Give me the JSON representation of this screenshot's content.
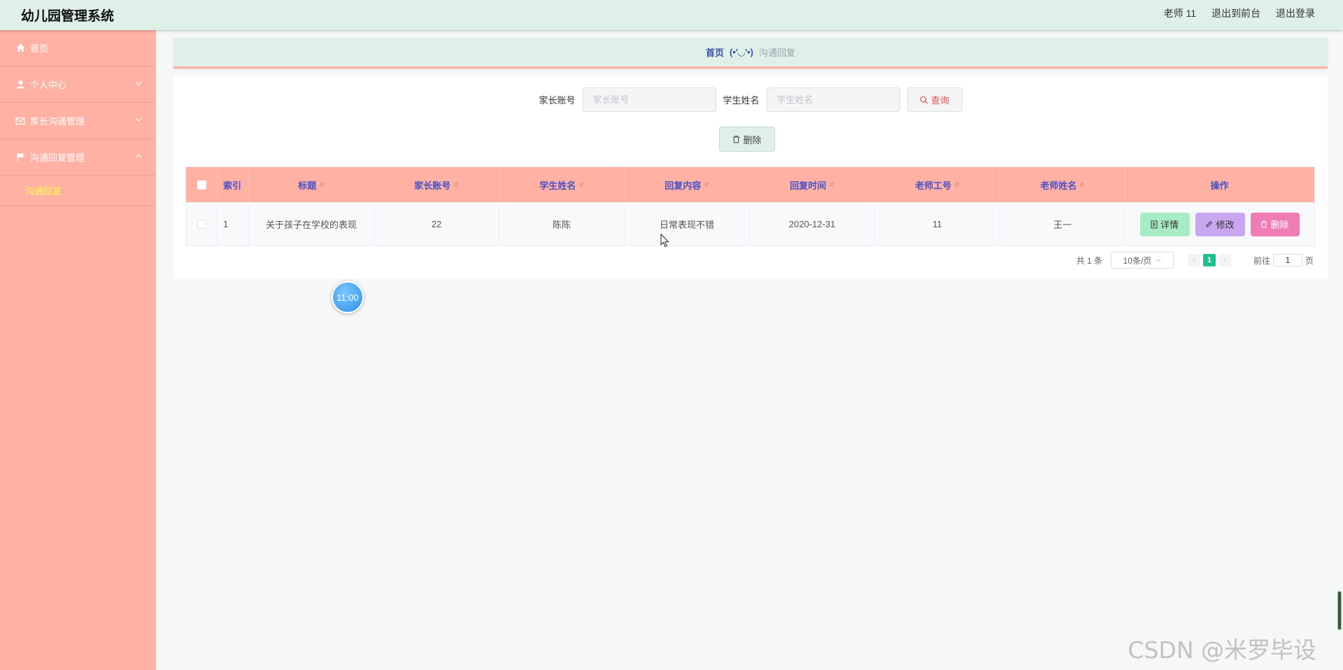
{
  "app": {
    "title": "幼儿园管理系统"
  },
  "topnav": {
    "user": "老师 11",
    "to_front": "退出到前台",
    "logout": "退出登录"
  },
  "sidebar": {
    "items": [
      {
        "label": "首页",
        "icon": "home-icon"
      },
      {
        "label": "个人中心",
        "icon": "user-icon"
      },
      {
        "label": "家长沟通管理",
        "icon": "mail-icon"
      },
      {
        "label": "沟通回复管理",
        "icon": "flag-icon"
      }
    ],
    "active_sub": "沟通回复"
  },
  "breadcrumb": {
    "home": "首页",
    "separator": "(•'◡'•)",
    "current": "沟通回复"
  },
  "search": {
    "parent_label": "家长账号",
    "parent_placeholder": "家长账号",
    "student_label": "学生姓名",
    "student_placeholder": "学生姓名",
    "query_label": "查询"
  },
  "toolbar": {
    "delete_label": "删除"
  },
  "table": {
    "headers": [
      "索引",
      "标题",
      "家长账号",
      "学生姓名",
      "回复内容",
      "回复时间",
      "老师工号",
      "老师姓名",
      "操作"
    ],
    "rows": [
      {
        "index": "1",
        "title": "关于孩子在学校的表现",
        "parent_account": "22",
        "student_name": "陈陈",
        "reply_content": "日常表现不错",
        "reply_time": "2020-12-31",
        "teacher_id": "11",
        "teacher_name": "王一"
      }
    ],
    "actions": {
      "detail": "详情",
      "edit": "修改",
      "delete": "删除"
    }
  },
  "pagination": {
    "total": "共 1 条",
    "page_size": "10条/页",
    "current_page": "1",
    "goto_prefix": "前往",
    "goto_value": "1",
    "goto_suffix": "页"
  },
  "clock": "11:00",
  "watermark": "CSDN @米罗毕设",
  "colors": {
    "sidebar": "#ffb1a3",
    "topbar": "#dff0e8",
    "header_text": "#4b52c8",
    "active_sub": "#ffff45",
    "page_active": "#1fbf8f"
  }
}
